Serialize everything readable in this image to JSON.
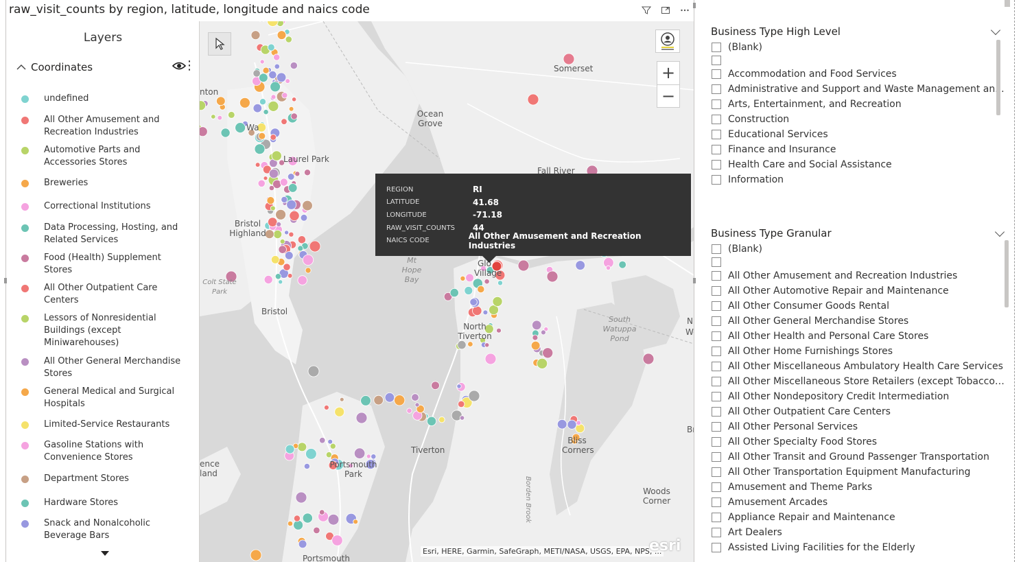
{
  "visual": {
    "title": "raw_visit_counts by region, latitude, longitude and naics code",
    "icons": [
      "filter-icon",
      "focus-mode-icon",
      "more-options-icon"
    ]
  },
  "layers": {
    "title": "Layers",
    "group_label": "Coordinates",
    "items": [
      {
        "label": "undefined",
        "color": "#7fd3d0"
      },
      {
        "label": "All Other Amusement and Recreation Industries",
        "color": "#f07775"
      },
      {
        "label": "Automotive Parts and Accessories Stores",
        "color": "#b8d468"
      },
      {
        "label": "Breweries",
        "color": "#f5a84a"
      },
      {
        "label": "Correctional Institutions",
        "color": "#f5a3e0"
      },
      {
        "label": "Data Processing, Hosting, and Related Services",
        "color": "#6cc4b4"
      },
      {
        "label": "Food (Health) Supplement Stores",
        "color": "#c97b9f"
      },
      {
        "label": "All Other Outpatient Care Centers",
        "color": "#f07775"
      },
      {
        "label": "Lessors of Nonresidential Buildings (except Miniwarehouses)",
        "color": "#b8d468"
      },
      {
        "label": "All Other General Merchandise Stores",
        "color": "#b98fc2"
      },
      {
        "label": "General Medical and Surgical Hospitals",
        "color": "#f5a84a"
      },
      {
        "label": "Limited-Service Restaurants",
        "color": "#f5e26b"
      },
      {
        "label": "Gasoline Stations with Convenience Stores",
        "color": "#f5a3e0"
      },
      {
        "label": "Department Stores",
        "color": "#c7a085"
      },
      {
        "label": "Hardware Stores",
        "color": "#6cc4b4"
      },
      {
        "label": "Snack and Nonalcoholic Beverage Bars",
        "color": "#9898e0"
      }
    ]
  },
  "map": {
    "places": [
      "Somerset",
      "Ocean Grove",
      "Fall River",
      "Bristol Highland",
      "Colt State Park",
      "Mt Hope Bay",
      "Glo Village",
      "North Tiverton",
      "South Watuppa Pond",
      "Tiverton",
      "Portsmouth Park",
      "Bliss Corners",
      "Woods Corner",
      "Portsmouth",
      "Laurel Park",
      "Bristol",
      "ence land",
      "nton",
      "Wa",
      "We",
      "Br",
      "N",
      "Borden Brook"
    ],
    "attribution": "Esri, HERE, Garmin, SafeGraph, METI/NASA, USGS, EPA, NPS, ...",
    "logo": "esri",
    "tooltip": {
      "rows": [
        {
          "key": "REGION",
          "value": "RI"
        },
        {
          "key": "LATITUDE",
          "value": "41.68"
        },
        {
          "key": "LONGITUDE",
          "value": "-71.18"
        },
        {
          "key": "RAW_VISIT_COUNTS",
          "value": "44"
        },
        {
          "key": "NAICS CODE",
          "value": "All Other Amusement and Recreation Industries"
        }
      ]
    }
  },
  "slicer_high": {
    "title": "Business Type High Level",
    "options": [
      "(Blank)",
      "",
      "Accommodation and Food Services",
      "Administrative and Support and Waste Management an...",
      "Arts, Entertainment, and Recreation",
      "Construction",
      "Educational Services",
      "Finance and Insurance",
      "Health Care and Social Assistance",
      "Information"
    ]
  },
  "slicer_granular": {
    "title": "Business Type Granular",
    "options": [
      "(Blank)",
      "",
      "All Other Amusement and Recreation Industries",
      "All Other Automotive Repair and Maintenance",
      "All Other Consumer Goods Rental",
      "All Other General Merchandise Stores",
      "All Other Health and Personal Care Stores",
      "All Other Home Furnishings Stores",
      "All Other Miscellaneous Ambulatory Health Care Services",
      "All Other Miscellaneous Store Retailers (except Tobacco St...",
      "All Other Nondepository Credit Intermediation",
      "All Other Outpatient Care Centers",
      "All Other Personal Services",
      "All Other Specialty Food Stores",
      "All Other Transit and Ground Passenger Transportation",
      "All Other Transportation Equipment Manufacturing",
      "Amusement and Theme Parks",
      "Amusement Arcades",
      "Appliance Repair and Maintenance",
      "Art Dealers",
      "Assisted Living Facilities for the Elderly"
    ]
  }
}
